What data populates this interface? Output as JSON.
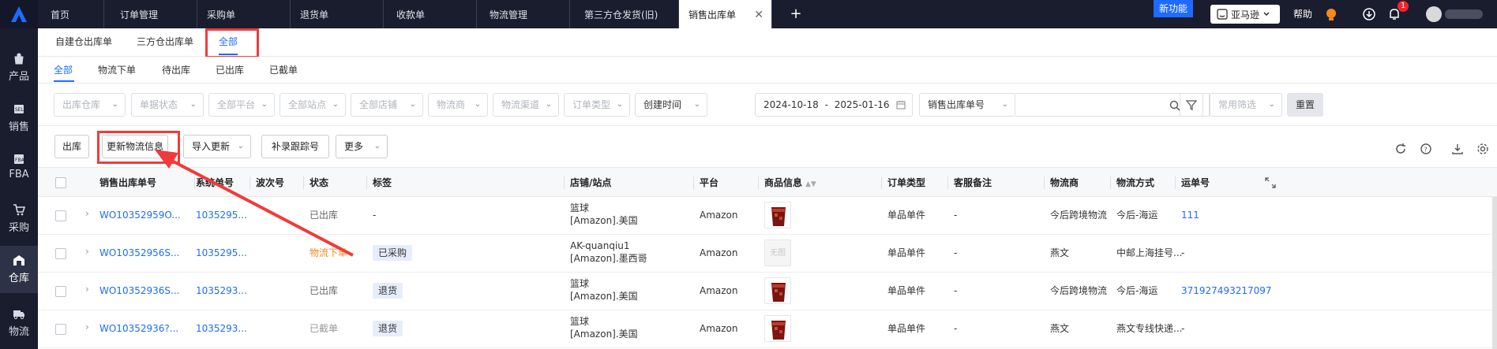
{
  "topbar": {
    "tabs": [
      {
        "label": "首页"
      },
      {
        "label": "订单管理"
      },
      {
        "label": "采购单"
      },
      {
        "label": "退货单"
      },
      {
        "label": "收款单"
      },
      {
        "label": "物流管理"
      },
      {
        "label": "第三方仓发货(旧)"
      },
      {
        "label": "销售出库单",
        "close": "✕"
      }
    ],
    "add_icon": "+",
    "new_feature": "新功能",
    "platform_select": "亚马逊",
    "help": "帮助",
    "notification_count": "1"
  },
  "leftnav": {
    "items": [
      {
        "label": "产品",
        "icon": "bag-icon"
      },
      {
        "label": "销售",
        "icon": "sale-icon"
      },
      {
        "label": "FBA",
        "icon": "fba-icon"
      },
      {
        "label": "采购",
        "icon": "cart-icon"
      },
      {
        "label": "仓库",
        "icon": "warehouse-icon",
        "active": true
      },
      {
        "label": "物流",
        "icon": "truck-icon"
      }
    ]
  },
  "subtabs": [
    "自建仓出库单",
    "三方仓出库单",
    "全部"
  ],
  "status_tabs": [
    "全部",
    "物流下单",
    "待出库",
    "已出库",
    "已截单"
  ],
  "filters": {
    "warehouse": "出库仓库",
    "doc_status": "单据状态",
    "platform": "全部平台",
    "site": "全部站点",
    "store": "全部店铺",
    "carrier": "物流商",
    "channel": "物流渠道",
    "order_type": "订单类型",
    "time_type": "创建时间",
    "date_from": "2024-10-18",
    "date_sep": "-",
    "date_to": "2025-01-16",
    "search_field": "销售出库单号",
    "common_filter": "常用筛选",
    "reset": "重置"
  },
  "actions": {
    "outbound": "出库",
    "update_logistics": "更新物流信息",
    "import_update": "导入更新",
    "add_tracking": "补录跟踪号",
    "more": "更多"
  },
  "table": {
    "headers": {
      "sales_no": "销售出库单号",
      "sys_no": "系统单号",
      "wave_no": "波次号",
      "status": "状态",
      "tags": "标签",
      "store_site": "店铺/站点",
      "platform": "平台",
      "product": "商品信息",
      "order_type": "订单类型",
      "cs_note": "客服备注",
      "carrier": "物流商",
      "method": "物流方式",
      "waybill": "运单号"
    },
    "rows": [
      {
        "sales_no": "WO10352959O...",
        "sys_no": "1035295...",
        "status": "已出库",
        "status_color": "#666666",
        "tag": "-",
        "store": "篮球",
        "site": "[Amazon].美国",
        "platform": "Amazon",
        "product_img": "drink",
        "order_type": "单品单件",
        "cs_note": "-",
        "carrier": "今后跨境物流",
        "method": "今后-海运",
        "waybill": "111"
      },
      {
        "sales_no": "WO10352956S...",
        "sys_no": "1035295...",
        "status": "物流下单",
        "status_color": "#f5891e",
        "tag": "已采购",
        "store": "AK-quanqiu1",
        "site": "[Amazon].墨西哥",
        "platform": "Amazon",
        "product_img": "无图",
        "order_type": "单品单件",
        "cs_note": "-",
        "carrier": "燕文",
        "method": "中邮上海挂号...",
        "waybill": "-"
      },
      {
        "sales_no": "WO10352936S...",
        "sys_no": "1035293...",
        "status": "已出库",
        "status_color": "#666666",
        "tag": "退货",
        "store": "篮球",
        "site": "[Amazon].美国",
        "platform": "Amazon",
        "product_img": "drink",
        "order_type": "单品单件",
        "cs_note": "-",
        "carrier": "今后跨境物流",
        "method": "今后-海运",
        "waybill": "371927493217097"
      },
      {
        "sales_no": "WO10352936?...",
        "sys_no": "1035293...",
        "status": "已截单",
        "status_color": "#999999",
        "tag": "退货",
        "store": "篮球",
        "site": "[Amazon].美国",
        "platform": "Amazon",
        "product_img": "drink",
        "order_type": "单品单件",
        "cs_note": "-",
        "carrier": "燕文",
        "method": "燕文专线快递...",
        "waybill": "-"
      }
    ]
  }
}
